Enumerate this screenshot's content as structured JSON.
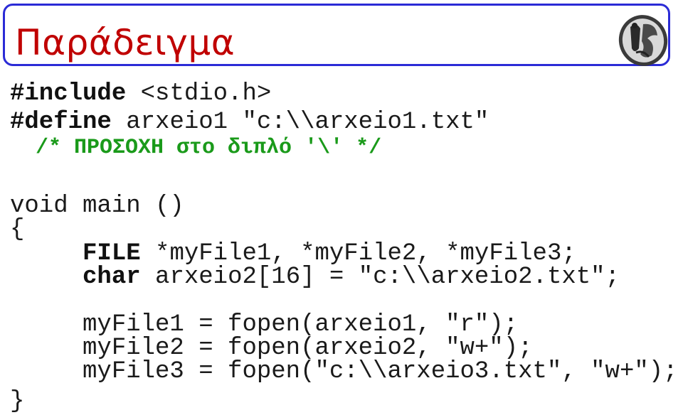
{
  "slide": {
    "title": "Παράδειγμα",
    "logo_icon": "university-coin-logo"
  },
  "code": {
    "lines": [
      {
        "keyword": "#include",
        "rest": " <stdio.h>"
      },
      {
        "keyword": "#define",
        "rest": " arxeio1 \"c:\\\\arxeio1.txt\""
      },
      {
        "comment": "  /* ΠΡΟΣΟΧΗ στο διπλό '\\' */"
      },
      {
        "plain": "void main ()"
      },
      {
        "plain": "{"
      },
      {
        "indent": "     ",
        "keyword": "FILE",
        "rest": " *myFile1, *myFile2, *myFile3;"
      },
      {
        "indent": "     ",
        "keyword": "char",
        "rest": " arxeio2[16] = \"c:\\\\arxeio2.txt\";"
      },
      {
        "plain": "     myFile1 = fopen(arxeio1, \"r\");"
      },
      {
        "plain": "     myFile2 = fopen(arxeio2, \"w+\");"
      },
      {
        "plain": "     myFile3 = fopen(\"c:\\\\arxeio3.txt\", \"w+\");"
      },
      {
        "plain": "}"
      }
    ]
  },
  "colors": {
    "title": "#c00000",
    "border": "#2b2bd6",
    "comment": "#1a9a1a"
  }
}
